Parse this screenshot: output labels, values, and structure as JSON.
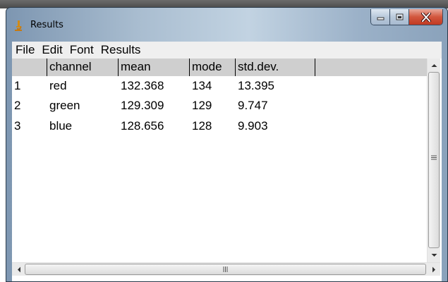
{
  "window": {
    "title": "Results"
  },
  "menu": [
    {
      "label": "File"
    },
    {
      "label": "Edit"
    },
    {
      "label": "Font"
    },
    {
      "label": "Results"
    }
  ],
  "table": {
    "columns": [
      "",
      "channel",
      "mean",
      "mode",
      "std.dev.",
      ""
    ],
    "rows": [
      [
        "1",
        "red",
        "132.368",
        "134",
        "13.395"
      ],
      [
        "2",
        "green",
        "129.309",
        "129",
        "9.747"
      ],
      [
        "3",
        "blue",
        "128.656",
        "128",
        "9.903"
      ]
    ]
  },
  "icons": {
    "app": "microscope-icon",
    "minimize": "minimize-icon",
    "maximize": "maximize-icon",
    "close": "close-icon",
    "scroll_up": "arrow-up-icon",
    "scroll_down": "arrow-down-icon",
    "scroll_left": "arrow-left-icon",
    "scroll_right": "arrow-right-icon"
  },
  "colors": {
    "header_bg": "#cfcfcf",
    "close_button": "#c84a32",
    "menubar_bg": "#efefef"
  }
}
